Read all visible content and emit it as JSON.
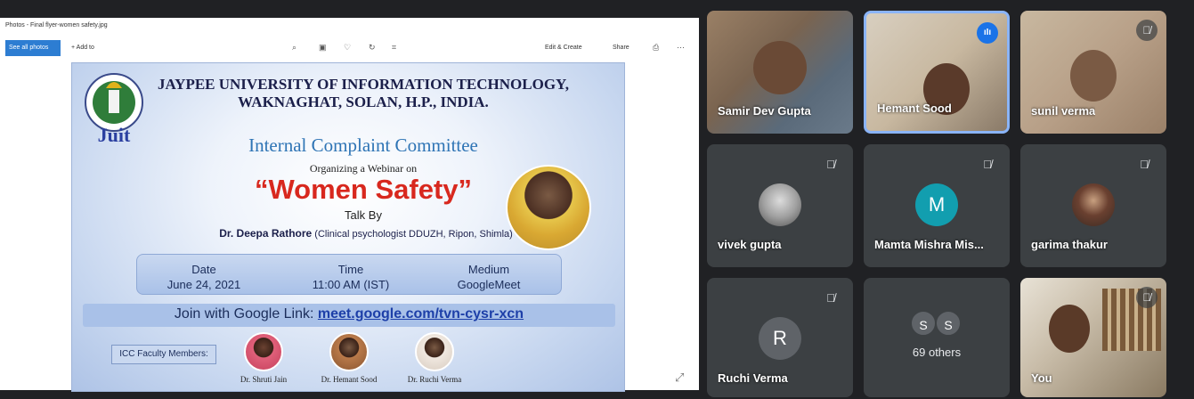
{
  "photos": {
    "window_title": "Photos - Final flyer-women safety.jpg",
    "see_all": "See all photos",
    "add_to": "+ Add to",
    "edit_create": "Edit & Create",
    "share": "Share"
  },
  "flyer": {
    "university_line1": "JAYPEE UNIVERSITY OF INFORMATION TECHNOLOGY,",
    "university_line2": "WAKNAGHAT, SOLAN, H.P., INDIA.",
    "logo_text": "Juit",
    "committee": "Internal Complaint Committee",
    "organizing": "Organizing a Webinar on",
    "title": "“Women Safety”",
    "talk_by": "Talk By",
    "speaker_name": "Dr. Deepa Rathore",
    "speaker_detail": "(Clinical psychologist DDUZH, Ripon, Shimla)",
    "date_label": "Date",
    "date_value": "June 24, 2021",
    "time_label": "Time",
    "time_value": "11:00 AM (IST)",
    "medium_label": "Medium",
    "medium_value": "GoogleMeet",
    "join_text": "Join with Google Link:",
    "join_link": "meet.google.com/tvn-cysr-xcn",
    "faculty_label": "ICC Faculty Members:",
    "faculty": [
      {
        "name": "Dr. Shruti Jain"
      },
      {
        "name": "Dr. Hemant Sood"
      },
      {
        "name": "Dr. Ruchi Verma"
      }
    ]
  },
  "participants": [
    {
      "name": "Samir Dev Gupta"
    },
    {
      "name": "Hemant Sood"
    },
    {
      "name": "sunil verma"
    },
    {
      "name": "vivek gupta"
    },
    {
      "name": "Mamta Mishra Mis...",
      "initial": "M"
    },
    {
      "name": "garima thakur"
    },
    {
      "name": "Ruchi Verma",
      "initial": "R"
    },
    {
      "name": "69 others",
      "initials": [
        "S",
        "S"
      ]
    },
    {
      "name": "You"
    }
  ],
  "colors": {
    "meet_bg": "#202124",
    "tile_bg": "#3c4043",
    "speaking_border": "#8ab4f8",
    "mamta_avatar": "#129eaf",
    "ruchi_avatar": "#5f6368",
    "title_red": "#d8281e",
    "committee_blue": "#2e74b5"
  }
}
